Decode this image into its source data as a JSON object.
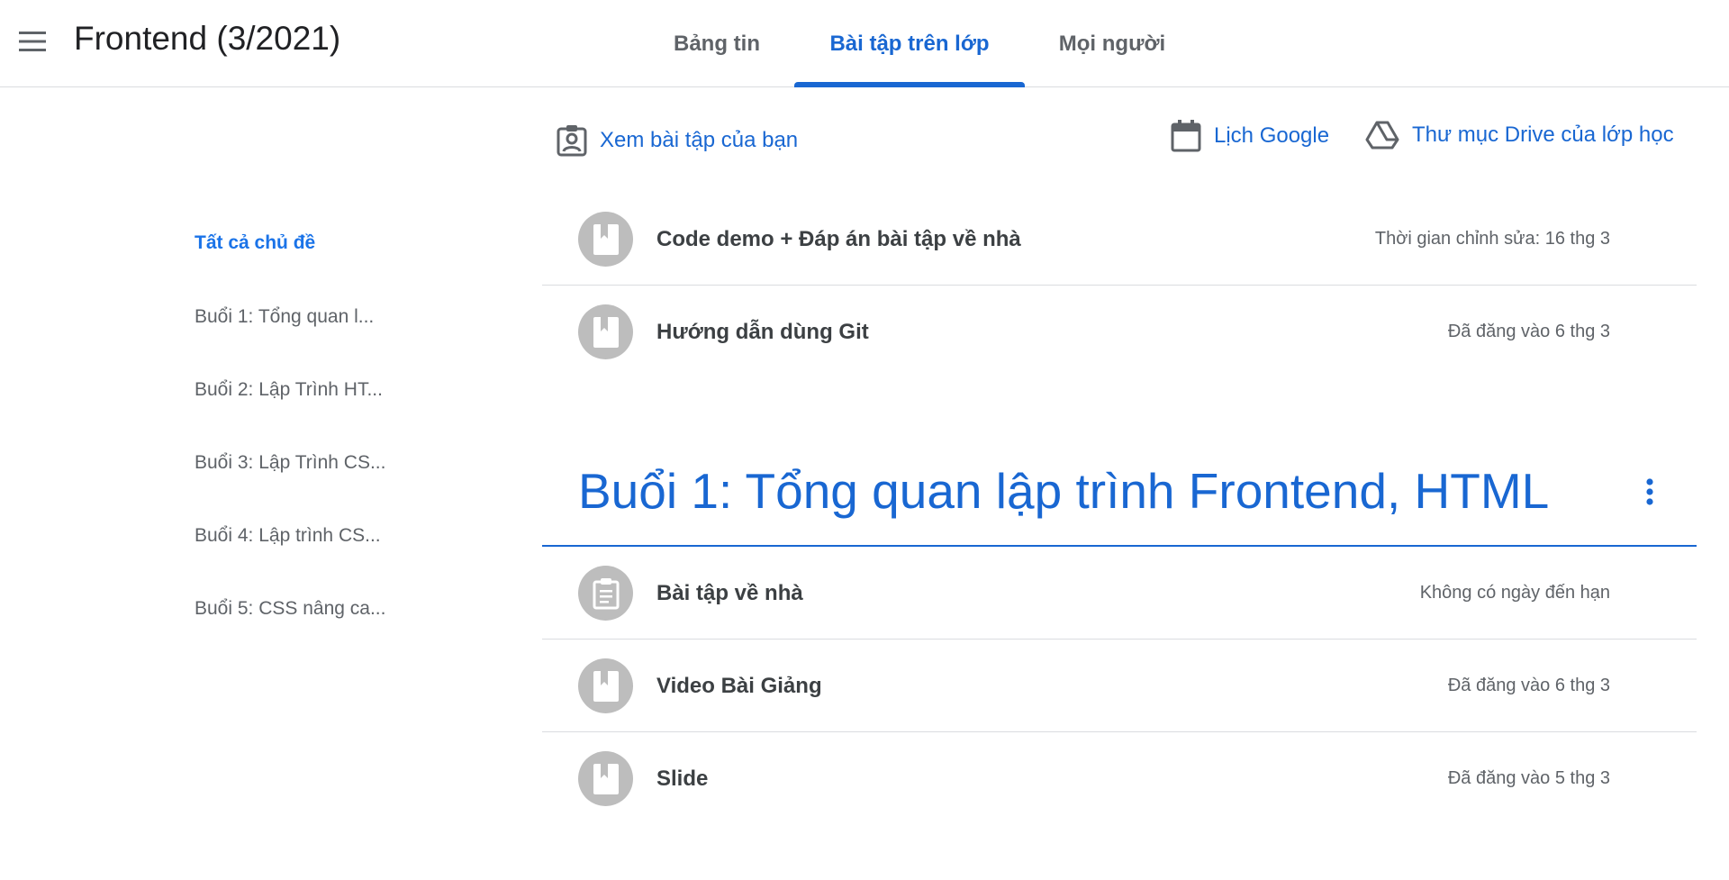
{
  "header": {
    "course_title": "Frontend (3/2021)",
    "tabs": [
      {
        "label": "Bảng tin",
        "active": false
      },
      {
        "label": "Bài tập trên lớp",
        "active": true
      },
      {
        "label": "Mọi người",
        "active": false
      }
    ]
  },
  "actions": {
    "view_work": "Xem bài tập của bạn",
    "google_calendar": "Lịch Google",
    "drive_folder": "Thư mục Drive của lớp học"
  },
  "sidebar": {
    "topics": [
      {
        "label": "Tất cả chủ đề",
        "active": true
      },
      {
        "label": "Buổi 1: Tổng quan l...",
        "active": false
      },
      {
        "label": "Buổi 2: Lập Trình HT...",
        "active": false
      },
      {
        "label": "Buổi 3: Lập Trình CS...",
        "active": false
      },
      {
        "label": "Buổi 4: Lập trình CS...",
        "active": false
      },
      {
        "label": "Buổi 5: CSS nâng ca...",
        "active": false
      }
    ]
  },
  "top_items": [
    {
      "title": "Code demo + Đáp án bài tập về nhà",
      "meta": "Thời gian chỉnh sửa: 16 thg 3",
      "icon": "material-icon"
    },
    {
      "title": "Hướng dẫn dùng Git",
      "meta": "Đã đăng vào 6 thg 3",
      "icon": "material-icon"
    }
  ],
  "topic": {
    "heading": "Buổi 1: Tổng quan lập trình Frontend, HTML",
    "items": [
      {
        "title": "Bài tập về nhà",
        "meta": "Không có ngày đến hạn",
        "icon": "assignment-icon"
      },
      {
        "title": "Video Bài Giảng",
        "meta": "Đã đăng vào 6 thg 3",
        "icon": "material-icon"
      },
      {
        "title": "Slide",
        "meta": "Đã đăng vào 5 thg 3",
        "icon": "material-icon"
      }
    ]
  },
  "colors": {
    "accent": "#1967d2",
    "icon_bg": "#bdbdbd",
    "divider": "#dadce0"
  }
}
